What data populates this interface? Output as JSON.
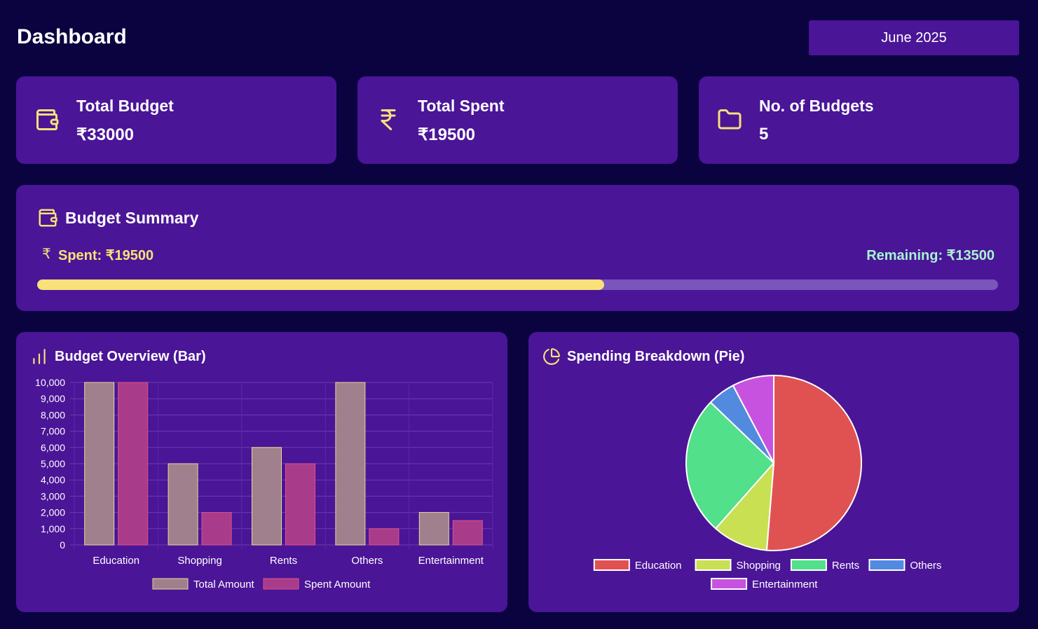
{
  "header": {
    "title": "Dashboard",
    "month_label": "June 2025"
  },
  "stats": [
    {
      "label": "Total Budget",
      "value": "₹33000",
      "icon": "wallet-icon"
    },
    {
      "label": "Total Spent",
      "value": "₹19500",
      "icon": "rupee-icon"
    },
    {
      "label": "No. of Budgets",
      "value": "5",
      "icon": "folder-icon"
    }
  ],
  "summary": {
    "title": "Budget Summary",
    "spent_symbol": "₹",
    "spent_label": "Spent: ₹19500",
    "remaining_label": "Remaining: ₹13500",
    "progress_fraction": 0.59
  },
  "colors": {
    "background": "#0a0340",
    "card": "#4a1597",
    "accent_yellow": "#f8e07a",
    "accent_mint": "#a6f4d0",
    "total_bar": "#a0808c",
    "spent_bar": "#a83c8a"
  },
  "bar_chart": {
    "title": "Budget Overview (Bar)"
  },
  "pie_chart": {
    "title": "Spending Breakdown (Pie)"
  },
  "chart_data": [
    {
      "type": "bar",
      "title": "Budget Overview (Bar)",
      "categories": [
        "Education",
        "Shopping",
        "Rents",
        "Others",
        "Entertainment"
      ],
      "series": [
        {
          "name": "Total Amount",
          "values": [
            10000,
            5000,
            6000,
            10000,
            2000
          ],
          "color": "#a0808c"
        },
        {
          "name": "Spent Amount",
          "values": [
            10000,
            2000,
            5000,
            1000,
            1500
          ],
          "color": "#a83c8a"
        }
      ],
      "ylim": [
        0,
        10000
      ],
      "yticks": [
        "0",
        "1,000",
        "2,000",
        "3,000",
        "4,000",
        "5,000",
        "6,000",
        "7,000",
        "8,000",
        "9,000",
        "10,000"
      ],
      "grid": true,
      "legend": "bottom"
    },
    {
      "type": "pie",
      "title": "Spending Breakdown (Pie)",
      "labels": [
        "Education",
        "Shopping",
        "Rents",
        "Others",
        "Entertainment"
      ],
      "values": [
        10000,
        2000,
        5000,
        1000,
        1500
      ],
      "colors": [
        "#e05252",
        "#c8e052",
        "#52e08a",
        "#528ae0",
        "#c852e0"
      ],
      "legend": "bottom"
    }
  ]
}
